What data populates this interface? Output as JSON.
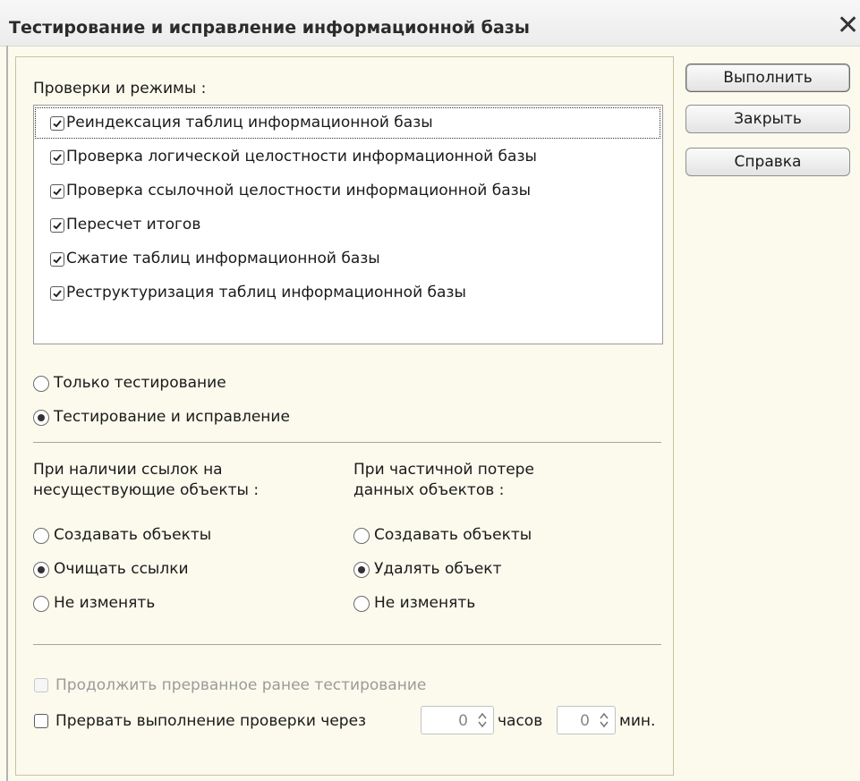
{
  "window": {
    "title": "Тестирование и исправление информационной базы"
  },
  "checks": {
    "label": "Проверки и режимы :",
    "items": [
      {
        "label": "Реиндексация таблиц информационной базы",
        "checked": true
      },
      {
        "label": "Проверка логической целостности информационной базы",
        "checked": true
      },
      {
        "label": "Проверка ссылочной целостности информационной базы",
        "checked": true
      },
      {
        "label": "Пересчет итогов",
        "checked": true
      },
      {
        "label": "Сжатие таблиц информационной базы",
        "checked": true
      },
      {
        "label": "Реструктуризация таблиц информационной базы",
        "checked": true
      }
    ]
  },
  "mode": {
    "options": [
      "Только тестирование",
      "Тестирование и исправление"
    ],
    "selected": "Тестирование и исправление"
  },
  "refs": {
    "label_line1": "При наличии ссылок на",
    "label_line2": "несуществующие объекты :",
    "options": [
      "Создавать объекты",
      "Очищать ссылки",
      "Не изменять"
    ],
    "selected": "Очищать ссылки"
  },
  "partial": {
    "label_line1": "При частичной потере",
    "label_line2": "данных объектов :",
    "options": [
      "Создавать объекты",
      "Удалять объект",
      "Не изменять"
    ],
    "selected": "Удалять объект"
  },
  "continue_testing": {
    "label": "Продолжить прерванное ранее тестирование",
    "checked": false,
    "enabled": false
  },
  "interrupt": {
    "label": "Прервать выполнение проверки через",
    "checked": false,
    "hours_value": "0",
    "hours_unit": "часов",
    "minutes_value": "0",
    "minutes_unit": "мин."
  },
  "buttons": {
    "run": "Выполнить",
    "close": "Закрыть",
    "help": "Справка"
  },
  "icons": {
    "close": "close-icon",
    "check": "checkmark-icon",
    "spin": "spinner-arrows-icon"
  },
  "colors": {
    "dialog_bg": "#fbfaed",
    "list_bg": "#ffffff",
    "frame": "#c7c3a1"
  }
}
